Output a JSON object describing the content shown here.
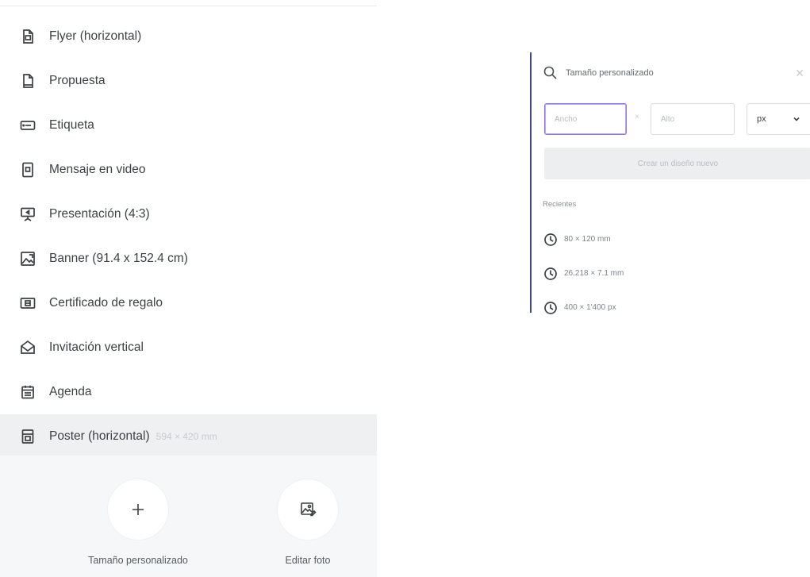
{
  "menu": {
    "items": [
      {
        "label": "Flyer (horizontal)",
        "icon": "flyer-document-icon"
      },
      {
        "label": "Propuesta",
        "icon": "proposal-document-icon"
      },
      {
        "label": "Etiqueta",
        "icon": "label-icon"
      },
      {
        "label": "Mensaje en video",
        "icon": "video-message-icon"
      },
      {
        "label": "Presentación (4:3)",
        "icon": "presentation-icon"
      },
      {
        "label": "Banner (91.4 x 152.4 cm)",
        "icon": "banner-image-icon"
      },
      {
        "label": "Certificado de regalo",
        "icon": "gift-certificate-icon"
      },
      {
        "label": "Invitación vertical",
        "icon": "invitation-envelope-icon"
      },
      {
        "label": "Agenda",
        "icon": "agenda-calendar-icon"
      },
      {
        "label": "Poster (horizontal)",
        "size": "594 × 420 mm",
        "icon": "poster-icon",
        "selected": true
      }
    ]
  },
  "actions": {
    "custom_size": {
      "label": "Tamaño personalizado",
      "icon": "plus-icon"
    },
    "edit_photo": {
      "label": "Editar foto",
      "icon": "edit-photo-icon"
    }
  },
  "custom_panel": {
    "search_placeholder": "Tamaño personalizado",
    "close_symbol": "✕",
    "width_placeholder": "Ancho",
    "height_placeholder": "Alto",
    "times_symbol": "×",
    "unit": "px",
    "create_button": "Crear un diseño nuevo",
    "recent_title": "Recientes",
    "recent_items": [
      "80 × 120 mm",
      "26.218 × 7.1 mm",
      "400 × 1'400 px"
    ]
  },
  "colors": {
    "panel_accent": "#3d4a7d",
    "focused_input": "#8e74e0",
    "selected_row": "#eef0f2"
  }
}
